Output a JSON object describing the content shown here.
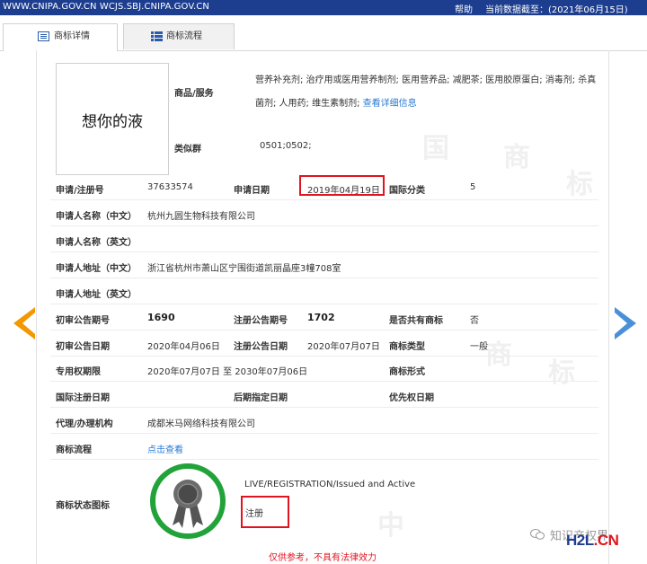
{
  "topbar": {
    "site": "WWW.CNIPA.GOV.CN WCJS.SBJ.CNIPA.GOV.CN",
    "help": "帮助",
    "status": "当前数据截至：(2021年06月15日)"
  },
  "tabs": [
    {
      "label": "商标详情",
      "icon": "list-icon",
      "active": true
    },
    {
      "label": "商标流程",
      "icon": "grid-list-icon",
      "active": false
    }
  ],
  "mark_image_text": "想你的液",
  "goods": {
    "label": "商品/服务",
    "text": "营养补充剂; 治疗用或医用营养制剂; 医用营养品; 减肥茶; 医用胶原蛋白; 消毒剂; 杀真菌剂; 人用药; 维生素制剂;",
    "link": "查看详细信息"
  },
  "similar_group": {
    "label": "类似群",
    "value": "0501;0502;"
  },
  "fields": {
    "reg_no_label": "申请/注册号",
    "reg_no": "37633574",
    "app_date_label": "申请日期",
    "app_date": "2019年04月19日",
    "intl_class_label": "国际分类",
    "intl_class": "5",
    "applicant_cn_label": "申请人名称（中文）",
    "applicant_cn": "杭州九圆生物科技有限公司",
    "applicant_en_label": "申请人名称（英文）",
    "address_cn_label": "申请人地址（中文）",
    "address_cn": "浙江省杭州市萧山区宁围街道凯丽晶座3幢708室",
    "address_en_label": "申请人地址（英文）",
    "prelim_no_label": "初审公告期号",
    "prelim_no": "1690",
    "reg_pub_no_label": "注册公告期号",
    "reg_pub_no": "1702",
    "shared_label": "是否共有商标",
    "shared": "否",
    "prelim_date_label": "初审公告日期",
    "prelim_date": "2020年04月06日",
    "reg_pub_date_label": "注册公告日期",
    "reg_pub_date": "2020年07月07日",
    "mark_type_label": "商标类型",
    "mark_type": "一般",
    "exclusive_label": "专用权期限",
    "exclusive": "2020年07月07日 至 2030年07月06日",
    "mark_form_label": "商标形式",
    "intl_reg_date_label": "国际注册日期",
    "later_date_label": "后期指定日期",
    "priority_date_label": "优先权日期",
    "agent_label": "代理/办理机构",
    "agent": "成都米马网络科技有限公司",
    "flow_label": "商标流程",
    "flow_link": "点击查看",
    "status_icon_label": "商标状态图标",
    "status_en": "LIVE/REGISTRATION/Issued and Active",
    "status_cn": "注册"
  },
  "footnote": "仅供参考，不具有法律效力",
  "watermark": {
    "wechat": "知识产权界",
    "brand_h2l": "H2L",
    "brand_cn": ".CN"
  },
  "colors": {
    "topbar": "#1d3d8f",
    "highlight": "#e0141e",
    "link": "#2a7bd3",
    "seal_ring": "#22a33a"
  }
}
